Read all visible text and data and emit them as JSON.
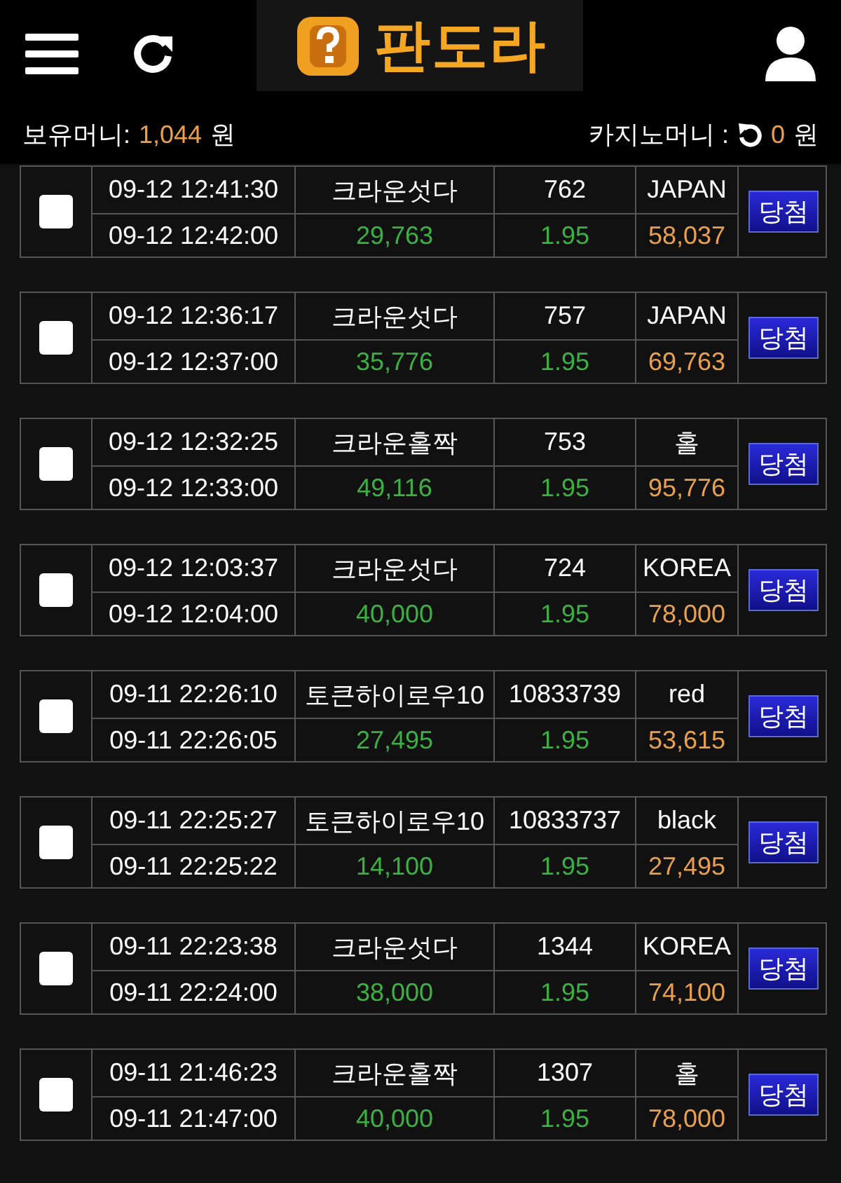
{
  "header": {
    "logo_text": "판도라"
  },
  "balance": {
    "label": "보유머니:",
    "amount": "1,044",
    "unit": "원",
    "casino_label": "카지노머니 :",
    "casino_amount": "0",
    "casino_unit": "원"
  },
  "bets": [
    {
      "checked": false,
      "bet_time": "09-12 12:41:30",
      "result_time": "09-12 12:42:00",
      "game": "크라운섯다",
      "amount": "29,763",
      "round": "762",
      "odds": "1.95",
      "pick": "JAPAN",
      "payout": "58,037",
      "status": "당첨"
    },
    {
      "checked": false,
      "bet_time": "09-12 12:36:17",
      "result_time": "09-12 12:37:00",
      "game": "크라운섯다",
      "amount": "35,776",
      "round": "757",
      "odds": "1.95",
      "pick": "JAPAN",
      "payout": "69,763",
      "status": "당첨"
    },
    {
      "checked": false,
      "bet_time": "09-12 12:32:25",
      "result_time": "09-12 12:33:00",
      "game": "크라운홀짝",
      "amount": "49,116",
      "round": "753",
      "odds": "1.95",
      "pick": "홀",
      "payout": "95,776",
      "status": "당첨"
    },
    {
      "checked": false,
      "bet_time": "09-12 12:03:37",
      "result_time": "09-12 12:04:00",
      "game": "크라운섯다",
      "amount": "40,000",
      "round": "724",
      "odds": "1.95",
      "pick": "KOREA",
      "payout": "78,000",
      "status": "당첨"
    },
    {
      "checked": false,
      "bet_time": "09-11 22:26:10",
      "result_time": "09-11 22:26:05",
      "game": "토큰하이로우10",
      "amount": "27,495",
      "round": "10833739",
      "odds": "1.95",
      "pick": "red",
      "payout": "53,615",
      "status": "당첨"
    },
    {
      "checked": false,
      "bet_time": "09-11 22:25:27",
      "result_time": "09-11 22:25:22",
      "game": "토큰하이로우10",
      "amount": "14,100",
      "round": "10833737",
      "odds": "1.95",
      "pick": "black",
      "payout": "27,495",
      "status": "당첨"
    },
    {
      "checked": false,
      "bet_time": "09-11 22:23:38",
      "result_time": "09-11 22:24:00",
      "game": "크라운섯다",
      "amount": "38,000",
      "round": "1344",
      "odds": "1.95",
      "pick": "KOREA",
      "payout": "74,100",
      "status": "당첨"
    },
    {
      "checked": false,
      "bet_time": "09-11 21:46:23",
      "result_time": "09-11 21:47:00",
      "game": "크라운홀짝",
      "amount": "40,000",
      "round": "1307",
      "odds": "1.95",
      "pick": "홀",
      "payout": "78,000",
      "status": "당첨"
    }
  ]
}
